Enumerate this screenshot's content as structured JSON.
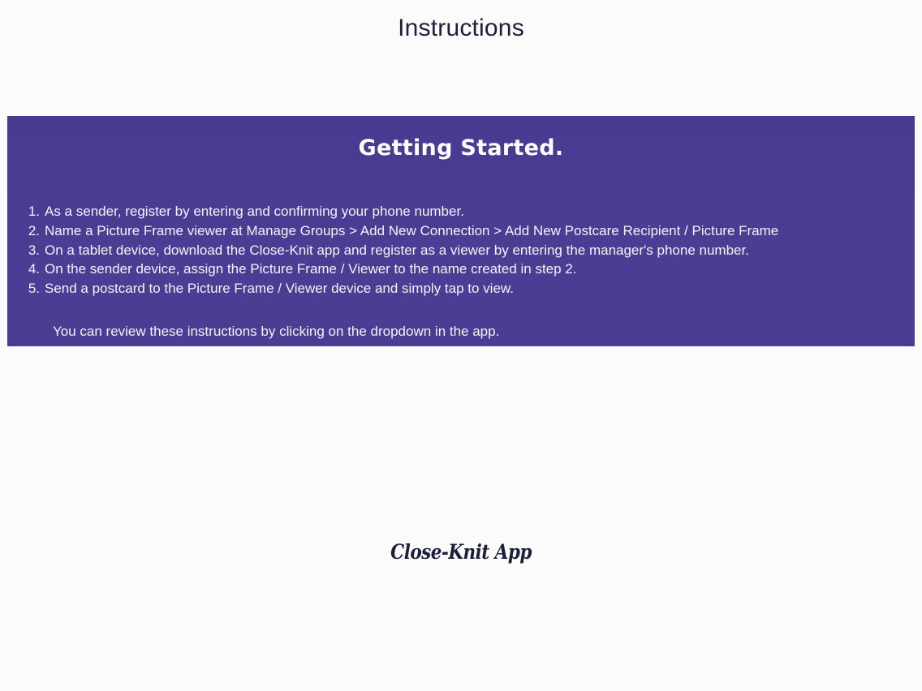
{
  "header": {
    "title": "Instructions"
  },
  "panel": {
    "heading": "Getting Started.",
    "steps": [
      {
        "number": "1.",
        "text": "As a sender, register by entering and confirming your phone number."
      },
      {
        "number": "2.",
        "text": "Name a Picture Frame viewer at Manage Groups > Add New Connection > Add New Postcare Recipient / Picture Frame"
      },
      {
        "number": "3.",
        "text": "On a tablet device, download the Close-Knit app and register as a viewer by entering the manager's phone number."
      },
      {
        "number": "4.",
        "text": "On the sender device, assign the Picture Frame / Viewer to the name created in step 2."
      },
      {
        "number": "5.",
        "text": "Send a postcard to the Picture Frame / Viewer device and simply tap to view."
      }
    ],
    "note": "You can review these instructions by clicking on the dropdown in the app."
  },
  "footer": {
    "brand": "Close-Knit App"
  },
  "colors": {
    "background": "#fcfbfb",
    "panel": "#4a3e94",
    "title_text": "#1b1f3b",
    "panel_text": "#ffffff"
  }
}
